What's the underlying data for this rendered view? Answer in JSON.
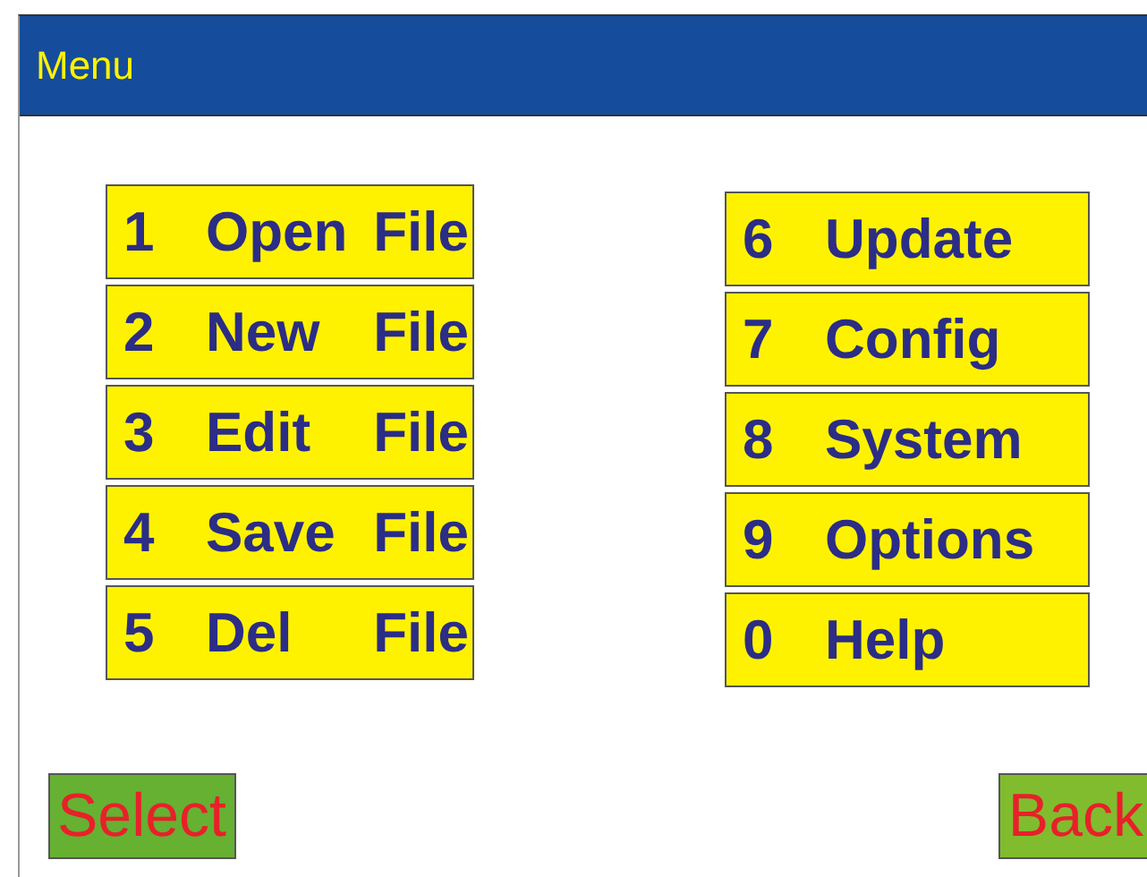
{
  "window": {
    "title": "Menu"
  },
  "menu_left": [
    {
      "key": "1",
      "label": "Open File"
    },
    {
      "key": "2",
      "label": "New File"
    },
    {
      "key": "3",
      "label": "Edit File"
    },
    {
      "key": "4",
      "label": "Save File"
    },
    {
      "key": "5",
      "label": "Del File"
    }
  ],
  "menu_right": [
    {
      "key": "6",
      "label": "Update"
    },
    {
      "key": "7",
      "label": "Config"
    },
    {
      "key": "8",
      "label": "System"
    },
    {
      "key": "9",
      "label": "Options"
    },
    {
      "key": "0",
      "label": "Help"
    }
  ],
  "buttons": [
    {
      "label": "Select"
    },
    {
      "label": "Back"
    }
  ]
}
